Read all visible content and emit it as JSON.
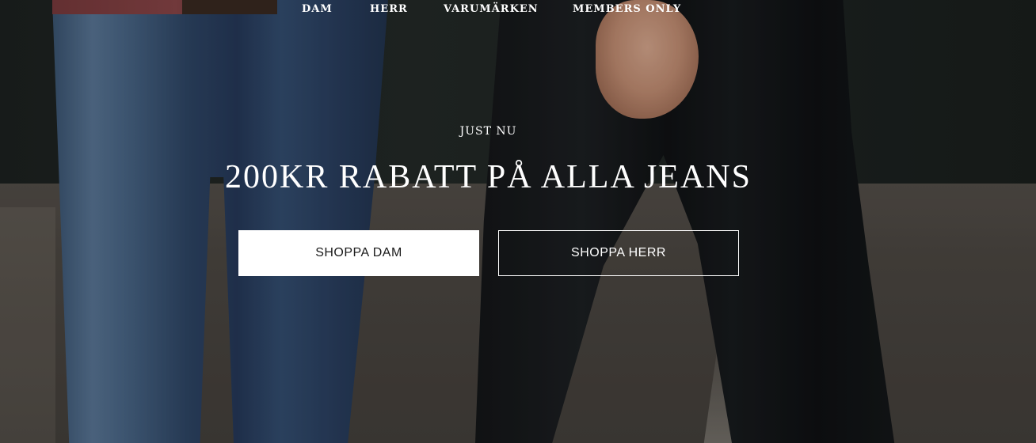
{
  "nav": {
    "items": [
      {
        "label": "DAM"
      },
      {
        "label": "HERR"
      },
      {
        "label": "VARUMÄRKEN"
      },
      {
        "label": "MEMBERS ONLY"
      }
    ]
  },
  "hero": {
    "eyebrow": "JUST NU",
    "headline": "200KR RABATT PÅ ALLA JEANS",
    "buttons": {
      "shop_women": "SHOPPA DAM",
      "shop_men": "SHOPPA HERR"
    },
    "background_image": "two-people-walking-in-jeans-photo"
  },
  "colors": {
    "text": "#ffffff",
    "primary_button_bg": "#ffffff",
    "primary_button_text": "#1a1a1a",
    "secondary_button_border": "#ffffff"
  }
}
